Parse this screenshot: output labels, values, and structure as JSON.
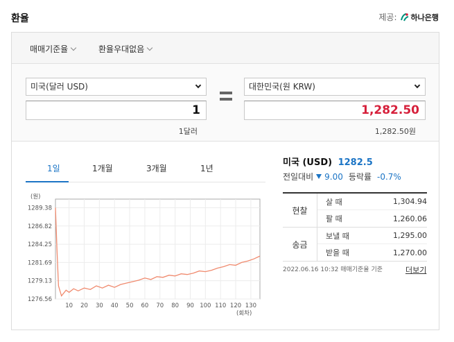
{
  "header": {
    "title": "환율",
    "provider_label": "제공:",
    "provider_name": "하나은행"
  },
  "filters": {
    "standard": "매매기준율",
    "preference": "환율우대없음"
  },
  "converter": {
    "from_currency": "미국(달러 USD)",
    "from_amount": "1",
    "from_sub": "1달러",
    "to_currency": "대한민국(원 KRW)",
    "to_amount": "1,282.50",
    "to_sub": "1,282.50원"
  },
  "tabs": [
    {
      "label": "1일",
      "active": true
    },
    {
      "label": "1개월",
      "active": false
    },
    {
      "label": "3개월",
      "active": false
    },
    {
      "label": "1년",
      "active": false
    }
  ],
  "info": {
    "country": "미국",
    "code": "(USD)",
    "rate": "1282.5",
    "prev_label": "전일대비",
    "change": "9.00",
    "pct_label": "등락률",
    "pct": "-0.7%"
  },
  "rates": {
    "cash": {
      "name": "현찰",
      "rows": [
        {
          "label": "살 때",
          "value": "1,304.94"
        },
        {
          "label": "팔 때",
          "value": "1,260.06"
        }
      ]
    },
    "remit": {
      "name": "송금",
      "rows": [
        {
          "label": "보낼 때",
          "value": "1,295.00"
        },
        {
          "label": "받을 때",
          "value": "1,270.00"
        }
      ]
    }
  },
  "footer": {
    "timestamp": "2022.06.16 10:32 매매기준율 기준",
    "more": "더보기"
  },
  "colors": {
    "accent": "#1b74c5",
    "highlight": "#d6203b",
    "line": "#f08a6e"
  },
  "chart_data": {
    "type": "line",
    "ylabel": "(원)",
    "xlabel": "(회차)",
    "y_ticks": [
      1276.56,
      1279.13,
      1281.69,
      1284.25,
      1286.82,
      1289.38
    ],
    "x_ticks": [
      10,
      20,
      30,
      40,
      50,
      60,
      70,
      80,
      90,
      100,
      110,
      120,
      130
    ],
    "ylim": [
      1276.56,
      1290.6
    ],
    "xlim": [
      1,
      136
    ],
    "series": [
      {
        "x": [
          1,
          2,
          3,
          5,
          8,
          10,
          13,
          16,
          20,
          24,
          28,
          32,
          36,
          40,
          44,
          48,
          52,
          56,
          60,
          64,
          68,
          72,
          76,
          80,
          84,
          88,
          92,
          96,
          100,
          104,
          108,
          112,
          116,
          120,
          124,
          128,
          132,
          136
        ],
        "values": [
          1289.4,
          1283.5,
          1278.4,
          1277.0,
          1277.8,
          1277.5,
          1278.0,
          1277.7,
          1278.1,
          1277.9,
          1278.4,
          1278.1,
          1278.5,
          1278.2,
          1278.6,
          1278.8,
          1279.0,
          1279.2,
          1279.5,
          1279.3,
          1279.7,
          1279.6,
          1279.9,
          1279.8,
          1280.1,
          1280.0,
          1280.2,
          1280.5,
          1280.4,
          1280.6,
          1280.9,
          1281.1,
          1281.4,
          1281.3,
          1281.7,
          1281.9,
          1282.2,
          1282.6
        ]
      }
    ]
  }
}
